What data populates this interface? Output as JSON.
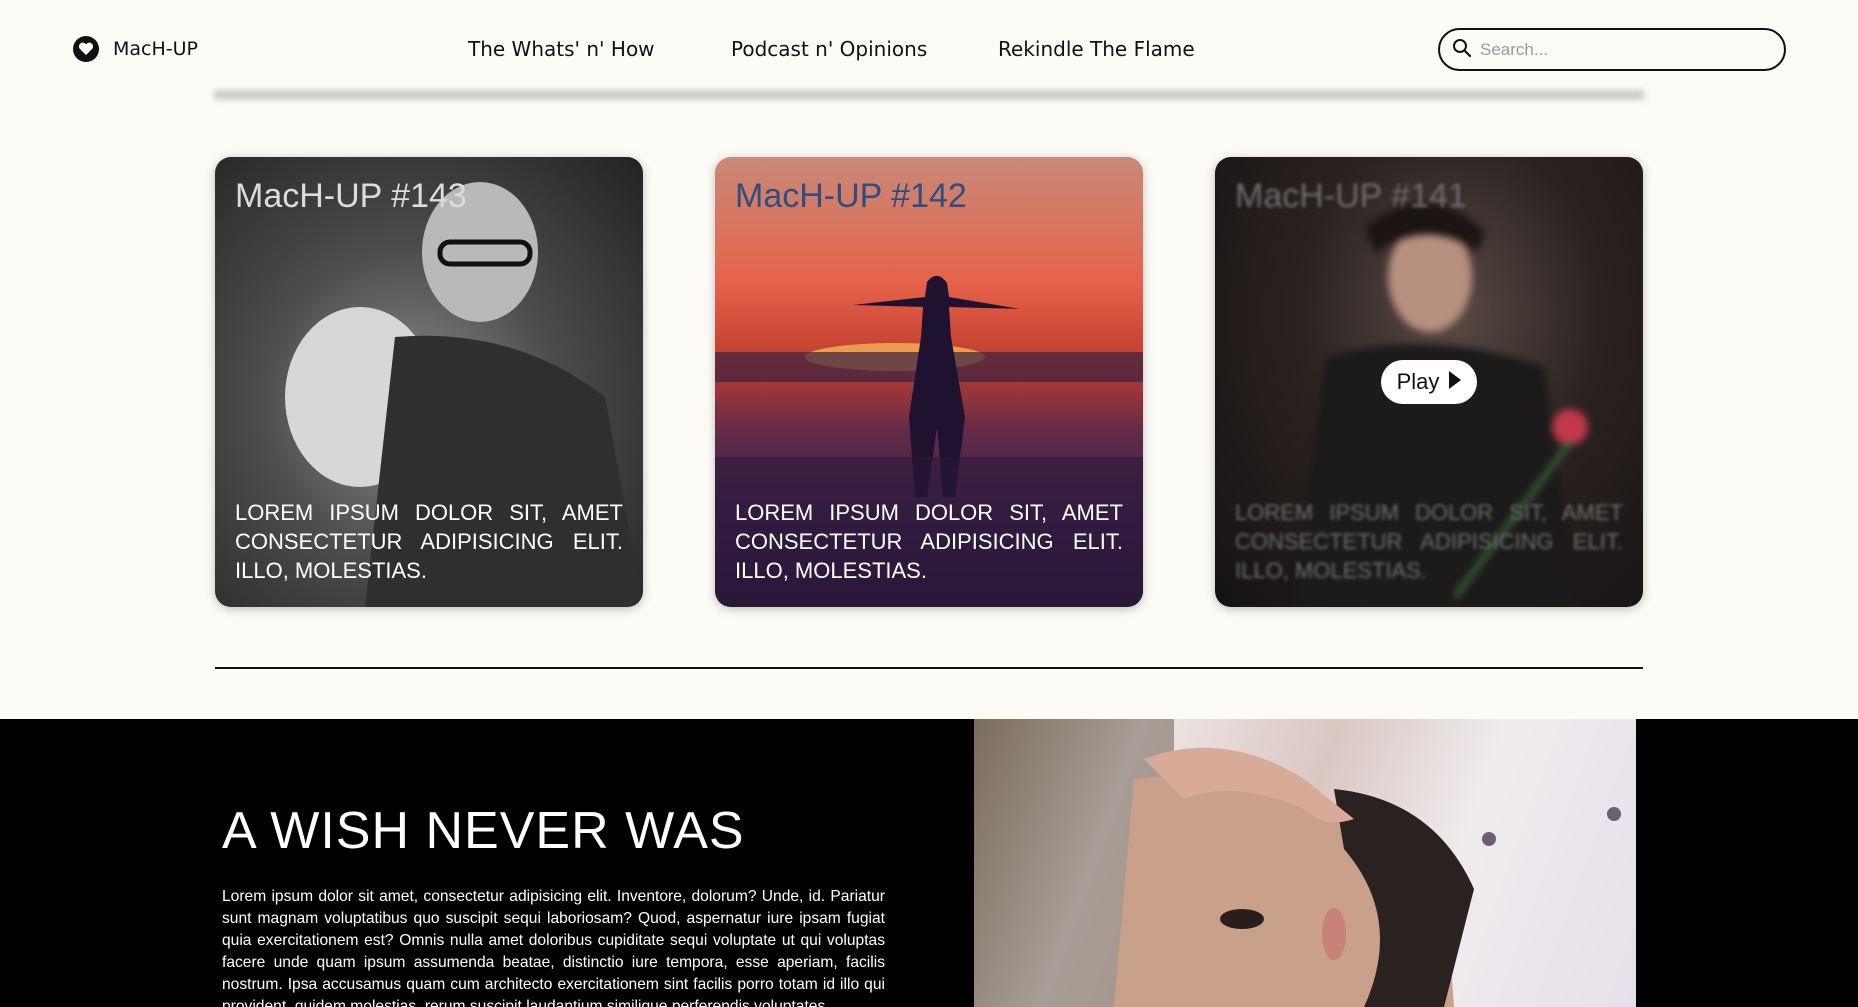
{
  "header": {
    "brand": "MacH-UP",
    "nav": [
      {
        "label": "The Whats' n' How"
      },
      {
        "label": "Podcast n' Opinions"
      },
      {
        "label": "Rekindle The Flame"
      }
    ],
    "search_placeholder": "Search..."
  },
  "cards": [
    {
      "title": "MacH-UP #143",
      "text": "LOREM IPSUM DOLOR SIT, AMET CONSECTETUR ADIPISICING ELIT. ILLO, MOLESTIAS."
    },
    {
      "title": "MacH-UP #142",
      "text": "LOREM IPSUM DOLOR SIT, AMET CONSECTETUR ADIPISICING ELIT. ILLO, MOLESTIAS."
    },
    {
      "title": "MacH-UP #141",
      "text": "LOREM IPSUM DOLOR SIT, AMET CONSECTETUR ADIPISICING ELIT. ILLO, MOLESTIAS.",
      "play_label": "Play"
    }
  ],
  "feature": {
    "title": "A WISH NEVER WAS",
    "body": "Lorem ipsum dolor sit amet, consectetur adipisicing elit. Inventore, dolorum? Unde, id. Pariatur sunt magnam voluptatibus quo suscipit sequi laboriosam? Quod, aspernatur iure ipsam fugiat quia exercitationem est? Omnis nulla amet doloribus cupiditate sequi voluptate ut qui voluptas facere unde quam ipsum assumenda beatae, distinctio iure tempora, esse aperiam, facilis nostrum. Ipsa accusamus quam cum architecto exercitationem sint facilis porro totam id illo qui provident, quidem molestias, rerum suscipit laudantium similique perferendis voluptates."
  }
}
